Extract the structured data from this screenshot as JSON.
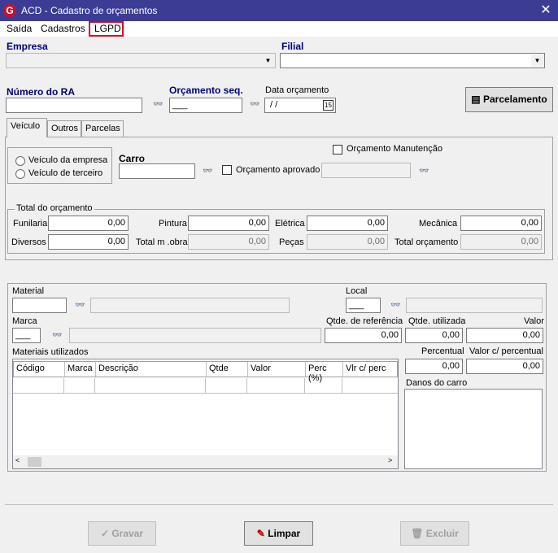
{
  "window": {
    "title": "ACD - Cadastro de orçamentos",
    "close_icon": "close-icon"
  },
  "menu": {
    "items": [
      "Saída",
      "Cadastros",
      "LGPD"
    ]
  },
  "header": {
    "empresa_label": "Empresa",
    "filial_label": "Filial",
    "numero_ra_label": "Número do RA",
    "orcamento_seq_label": "Orçamento seq.",
    "orcamento_seq_value": "___",
    "data_orcamento_label": "Data orçamento",
    "data_orcamento_value": " / /",
    "parcelamento_label": "Parcelamento"
  },
  "tabs": [
    "Veículo",
    "Outros",
    "Parcelas"
  ],
  "vehicle": {
    "radio_empresa": "Veículo da empresa",
    "radio_terceiro": "Veículo de terceiro",
    "carro_label": "Carro",
    "orcamento_manutencao_label": "Orçamento Manutenção",
    "orcamento_aprovado_label": "Orçamento aprovado"
  },
  "total": {
    "group_label": "Total do orçamento",
    "funilaria_label": "Funilaria",
    "funilaria_value": "0,00",
    "pintura_label": "Pintura",
    "pintura_value": "0,00",
    "eletrica_label": "Elétrica",
    "eletrica_value": "0,00",
    "mecanica_label": "Mecânica",
    "mecanica_value": "0,00",
    "diversos_label": "Diversos",
    "diversos_value": "0,00",
    "total_mobra_label": "Total m .obra",
    "total_mobra_value": "0,00",
    "pecas_label": "Peças",
    "pecas_value": "0,00",
    "total_orcamento_label": "Total orçamento",
    "total_orcamento_value": "0,00"
  },
  "material": {
    "material_label": "Material",
    "local_label": "Local",
    "local_value": "___",
    "marca_label": "Marca",
    "marca_value": "___",
    "qtde_referencia_label": "Qtde. de referência",
    "qtde_referencia_value": "0,00",
    "qtde_utilizada_label": "Qtde. utilizada",
    "qtde_utilizada_value": "0,00",
    "valor_label": "Valor",
    "valor_value": "0,00",
    "materiais_utilizados_label": "Materiais utilizados",
    "percentual_label": "Percentual",
    "percentual_value": "0,00",
    "valor_percentual_label": "Valor c/ percentual",
    "valor_percentual_value": "0,00",
    "danos_label": "Danos do carro",
    "columns": [
      "Código",
      "Marca",
      "Descrição",
      "Qtde",
      "Valor",
      "Perc (%)",
      "Vlr c/ perc"
    ]
  },
  "footer": {
    "gravar_label": "Gravar",
    "limpar_label": "Limpar",
    "excluir_label": "Excluir"
  }
}
